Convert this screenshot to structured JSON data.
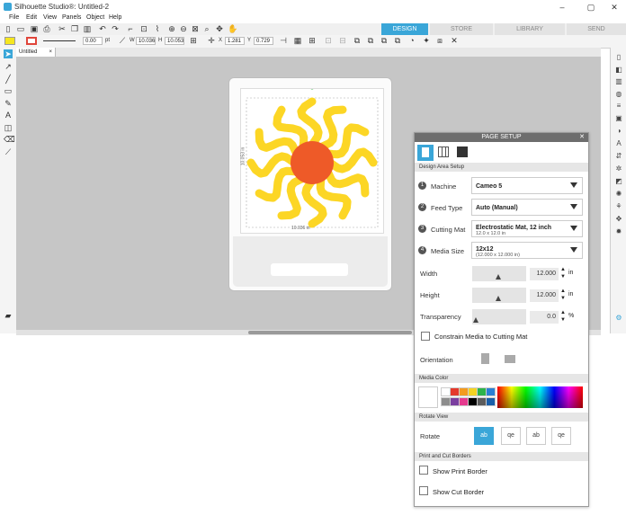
{
  "window": {
    "title": "Silhouette Studio®: Untitled-2",
    "min": "–",
    "max": "▢",
    "close": "✕"
  },
  "menu": [
    "File",
    "Edit",
    "View",
    "Panels",
    "Object",
    "Help"
  ],
  "tabs": {
    "design": "DESIGN",
    "store": "STORE",
    "library": "LIBRARY",
    "send": "SEND"
  },
  "props": {
    "line_width": "0.00",
    "pt": "pt",
    "w": "10.036",
    "h": "10.053",
    "x": "1.281",
    "y": "0.729",
    "w_label": "W",
    "h_label": "H",
    "x_label": "X",
    "y_label": "Y"
  },
  "document_tab": "Untitled",
  "dimensions": {
    "width_label": "10.036 in",
    "height_label": "10.053 in"
  },
  "colors": {
    "accent": "#3aa6d8",
    "sun_center": "#ee5a28",
    "sun_rays": "#fcd625",
    "ray_outline": "#f2bb0f"
  },
  "panel": {
    "title": "PAGE SETUP",
    "close": "✕",
    "design_area_setup": "Design Area Setup",
    "rows": [
      {
        "n": "1",
        "label": "Machine",
        "value": "Cameo 5",
        "sub": ""
      },
      {
        "n": "2",
        "label": "Feed Type",
        "value": "Auto (Manual)",
        "sub": ""
      },
      {
        "n": "3",
        "label": "Cutting Mat",
        "value": "Electrostatic Mat, 12 inch",
        "sub": "12.0 x 12.0 in"
      },
      {
        "n": "4",
        "label": "Media Size",
        "value": "12x12",
        "sub": "(12.000 x 12.000 in)"
      }
    ],
    "width": {
      "label": "Width",
      "value": "12.000",
      "unit": "in"
    },
    "height": {
      "label": "Height",
      "value": "12.000",
      "unit": "in"
    },
    "transparency": {
      "label": "Transparency",
      "value": "0.0",
      "unit": "%"
    },
    "constrain": "Constrain Media to Cutting Mat",
    "orientation": "Orientation",
    "media_color": "Media Color",
    "swatches": [
      "#ffffff",
      "#e53a2c",
      "#f39b1f",
      "#f4d323",
      "#2db34a",
      "#2a7fd3",
      "#8d8d8d",
      "#7b3fa0",
      "#e53a8e",
      "#000000",
      "#5c5c5c",
      "#1a5ea8"
    ],
    "rotate_view": "Rotate View",
    "rotate": "Rotate",
    "rotate_options": [
      "ab",
      "qe",
      "ab",
      "qe"
    ],
    "print_cut_borders": "Print and Cut Borders",
    "show_print_border": "Show Print Border",
    "show_cut_border": "Show Cut Border"
  }
}
